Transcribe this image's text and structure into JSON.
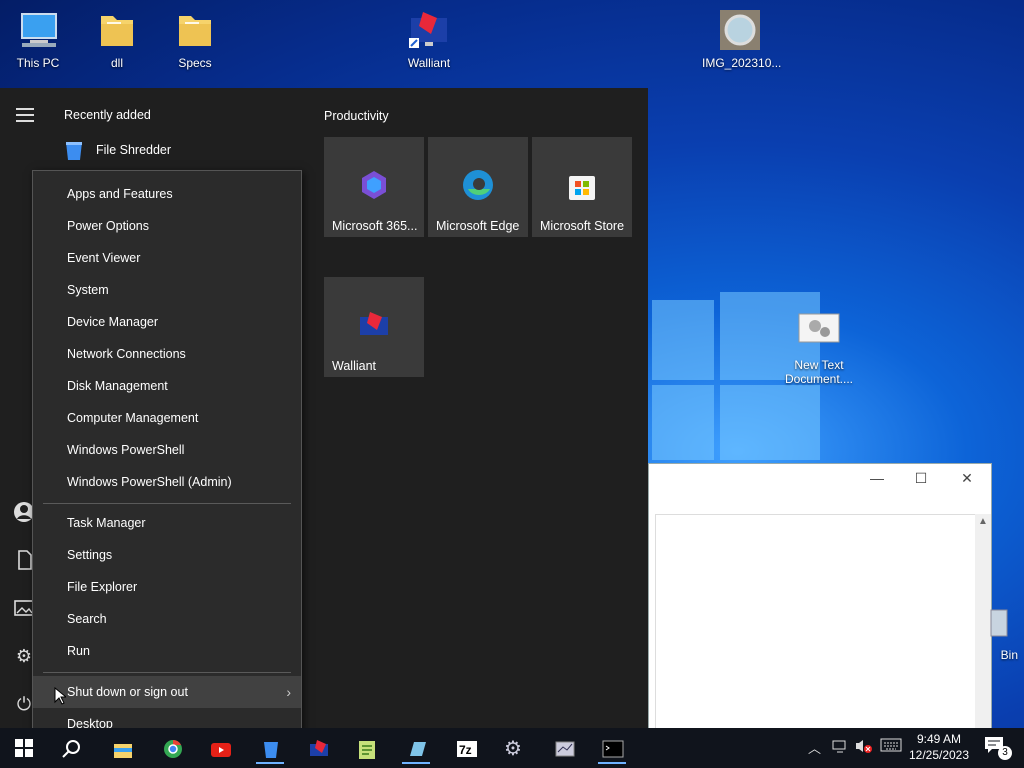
{
  "desktop": {
    "icons": [
      {
        "label": "This PC",
        "icon": "computer-icon"
      },
      {
        "label": "dll",
        "icon": "folder-icon"
      },
      {
        "label": "Specs",
        "icon": "folder-icon"
      },
      {
        "label": "Walliant",
        "icon": "walliant-icon"
      },
      {
        "label": "IMG_202310...",
        "icon": "image-file-icon"
      },
      {
        "label": "New Text Document....",
        "icon": "text-document-icon"
      },
      {
        "label": "Bin",
        "icon": "recycle-bin-icon"
      }
    ]
  },
  "start_menu": {
    "recently_added_heading": "Recently added",
    "recent_app": "File Shredder",
    "productivity_heading": "Productivity",
    "tiles": [
      {
        "label": "Microsoft 365...",
        "icon": "microsoft-365-icon"
      },
      {
        "label": "Microsoft Edge",
        "icon": "edge-icon"
      },
      {
        "label": "Microsoft Store",
        "icon": "store-icon"
      },
      {
        "label": "Walliant",
        "icon": "walliant-icon"
      }
    ]
  },
  "context_menu": {
    "group1": [
      "Apps and Features",
      "Power Options",
      "Event Viewer",
      "System",
      "Device Manager",
      "Network Connections",
      "Disk Management",
      "Computer Management",
      "Windows PowerShell",
      "Windows PowerShell (Admin)"
    ],
    "group2": [
      "Task Manager",
      "Settings",
      "File Explorer",
      "Search",
      "Run"
    ],
    "shutdown": "Shut down or sign out",
    "desktop": "Desktop"
  },
  "notepad": {
    "minimize": "—",
    "maximize": "☐",
    "close": "✕"
  },
  "taskbar": {
    "time": "9:49 AM",
    "date": "12/25/2023",
    "notification_count": "3"
  },
  "colors": {
    "accent": "#6fb2ff",
    "start_bg": "#1f1f1f",
    "menu_bg": "#2b2b2b",
    "taskbar_bg": "#10141c"
  }
}
